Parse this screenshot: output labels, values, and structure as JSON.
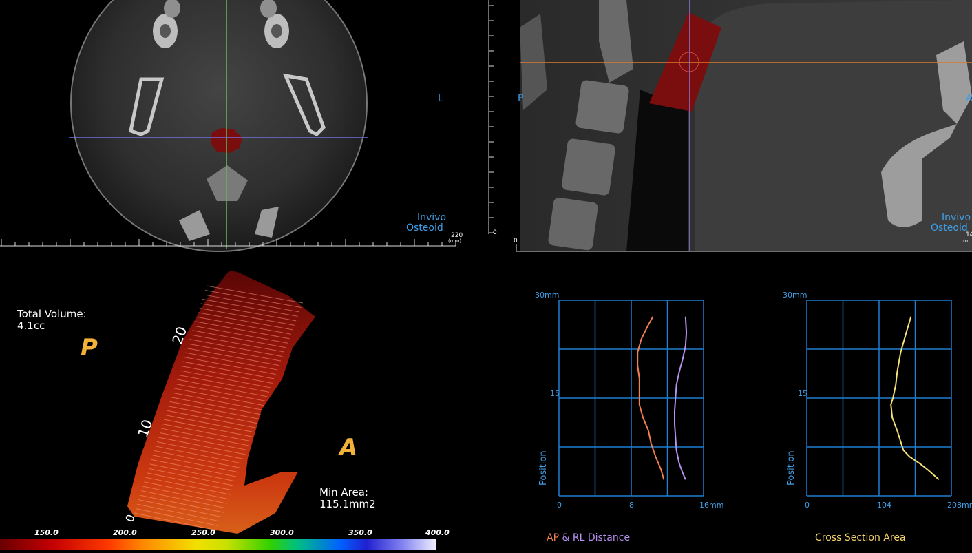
{
  "axial_view": {
    "orientation_left": "L",
    "watermark_line1": "Invivo",
    "watermark_line2": "Osteoid",
    "ruler_end": "220",
    "ruler_unit": "(mm)"
  },
  "sagittal_view": {
    "orientation_posterior": "P",
    "orientation_anterior": "A",
    "watermark_line1": "Invivo",
    "watermark_line2": "Osteoid",
    "ruler_zero_v": "0",
    "ruler_zero_h": "0",
    "ruler_end": "14",
    "ruler_unit": "(m"
  },
  "volume_view": {
    "total_volume_label": "Total Volume:",
    "total_volume_value": "4.1cc",
    "min_area_label": "Min Area:",
    "min_area_value": "115.1mm2",
    "orientation_p": "P",
    "orientation_a": "A",
    "scale_20": "20",
    "scale_10": "10",
    "scale_0": "0"
  },
  "colorbar": {
    "labels": [
      "150.0",
      "200.0",
      "250.0",
      "300.0",
      "350.0",
      "400.0"
    ]
  },
  "chart_data": [
    {
      "type": "line",
      "title": "AP & RL Distance",
      "title_part1": "AP",
      "title_part2": "&",
      "title_part3": "RL Distance",
      "xlabel": "",
      "ylabel": "Position",
      "x_ticks": [
        "0",
        "8",
        "16mm"
      ],
      "y_ticks": [
        "30mm",
        "15"
      ],
      "xlim": [
        0,
        16
      ],
      "ylim": [
        0,
        30
      ],
      "series": [
        {
          "color": "#f08050",
          "points": [
            [
              10.4,
              27.5
            ],
            [
              9.8,
              26
            ],
            [
              9.1,
              24
            ],
            [
              8.7,
              22
            ],
            [
              8.7,
              20
            ],
            [
              8.9,
              18
            ],
            [
              8.9,
              16
            ],
            [
              8.9,
              14
            ],
            [
              9.3,
              12
            ],
            [
              9.9,
              10
            ],
            [
              10.2,
              8
            ],
            [
              10.7,
              6
            ],
            [
              11.3,
              4
            ],
            [
              11.6,
              2.5
            ]
          ]
        },
        {
          "color": "#b892f0",
          "points": [
            [
              14.0,
              27.5
            ],
            [
              14.1,
              25
            ],
            [
              14.0,
              23
            ],
            [
              13.7,
              21
            ],
            [
              13.3,
              19
            ],
            [
              13.0,
              17
            ],
            [
              12.9,
              15
            ],
            [
              12.8,
              13
            ],
            [
              12.8,
              11
            ],
            [
              12.9,
              9
            ],
            [
              13.0,
              7
            ],
            [
              13.3,
              5
            ],
            [
              13.7,
              3.5
            ],
            [
              14.0,
              2.5
            ]
          ]
        }
      ]
    },
    {
      "type": "line",
      "title": "Cross Section Area",
      "xlabel": "",
      "ylabel": "Position",
      "x_ticks": [
        "0",
        "104",
        "208mm2"
      ],
      "y_ticks": [
        "30mm",
        "15"
      ],
      "xlim": [
        0,
        208
      ],
      "ylim": [
        0,
        30
      ],
      "series": [
        {
          "color": "#f6e07a",
          "points": [
            [
              150,
              27.5
            ],
            [
              143,
              25
            ],
            [
              135,
              22
            ],
            [
              130,
              19
            ],
            [
              128,
              17
            ],
            [
              124,
              15
            ],
            [
              121,
              14
            ],
            [
              123,
              12
            ],
            [
              130,
              10
            ],
            [
              139,
              7
            ],
            [
              148,
              6
            ],
            [
              162,
              5
            ],
            [
              174,
              4
            ],
            [
              190,
              2.5
            ]
          ]
        }
      ]
    }
  ]
}
